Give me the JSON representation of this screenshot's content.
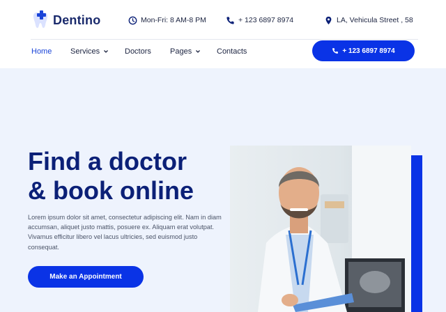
{
  "brand": {
    "name": "Dentino"
  },
  "topbar": {
    "hours": "Mon-Fri: 8 AM-8 PM",
    "phone": "+ 123 6897 8974",
    "address": "LA, Vehicula Street , 58"
  },
  "nav": {
    "items": [
      {
        "label": "Home",
        "active": true
      },
      {
        "label": "Services",
        "dropdown": true
      },
      {
        "label": "Doctors"
      },
      {
        "label": "Pages",
        "dropdown": true
      },
      {
        "label": "Contacts"
      }
    ],
    "cta": {
      "label": "+ 123 6897 8974",
      "icon": "phone-icon"
    }
  },
  "hero": {
    "title_line1": "Find a doctor",
    "title_line2": "& book online",
    "description": "Lorem ipsum dolor sit amet, consectetur adipiscing elit. Nam in diam accumsan, aliquet justo mattis, posuere ex. Aliquam erat volutpat. Vivamus efficitur libero vel lacus ultricies, sed euismod justo consequat.",
    "button_label": "Make an Appointment"
  },
  "colors": {
    "accent": "#0a33e6",
    "heading": "#0b2077",
    "background": "#eef3fd"
  }
}
